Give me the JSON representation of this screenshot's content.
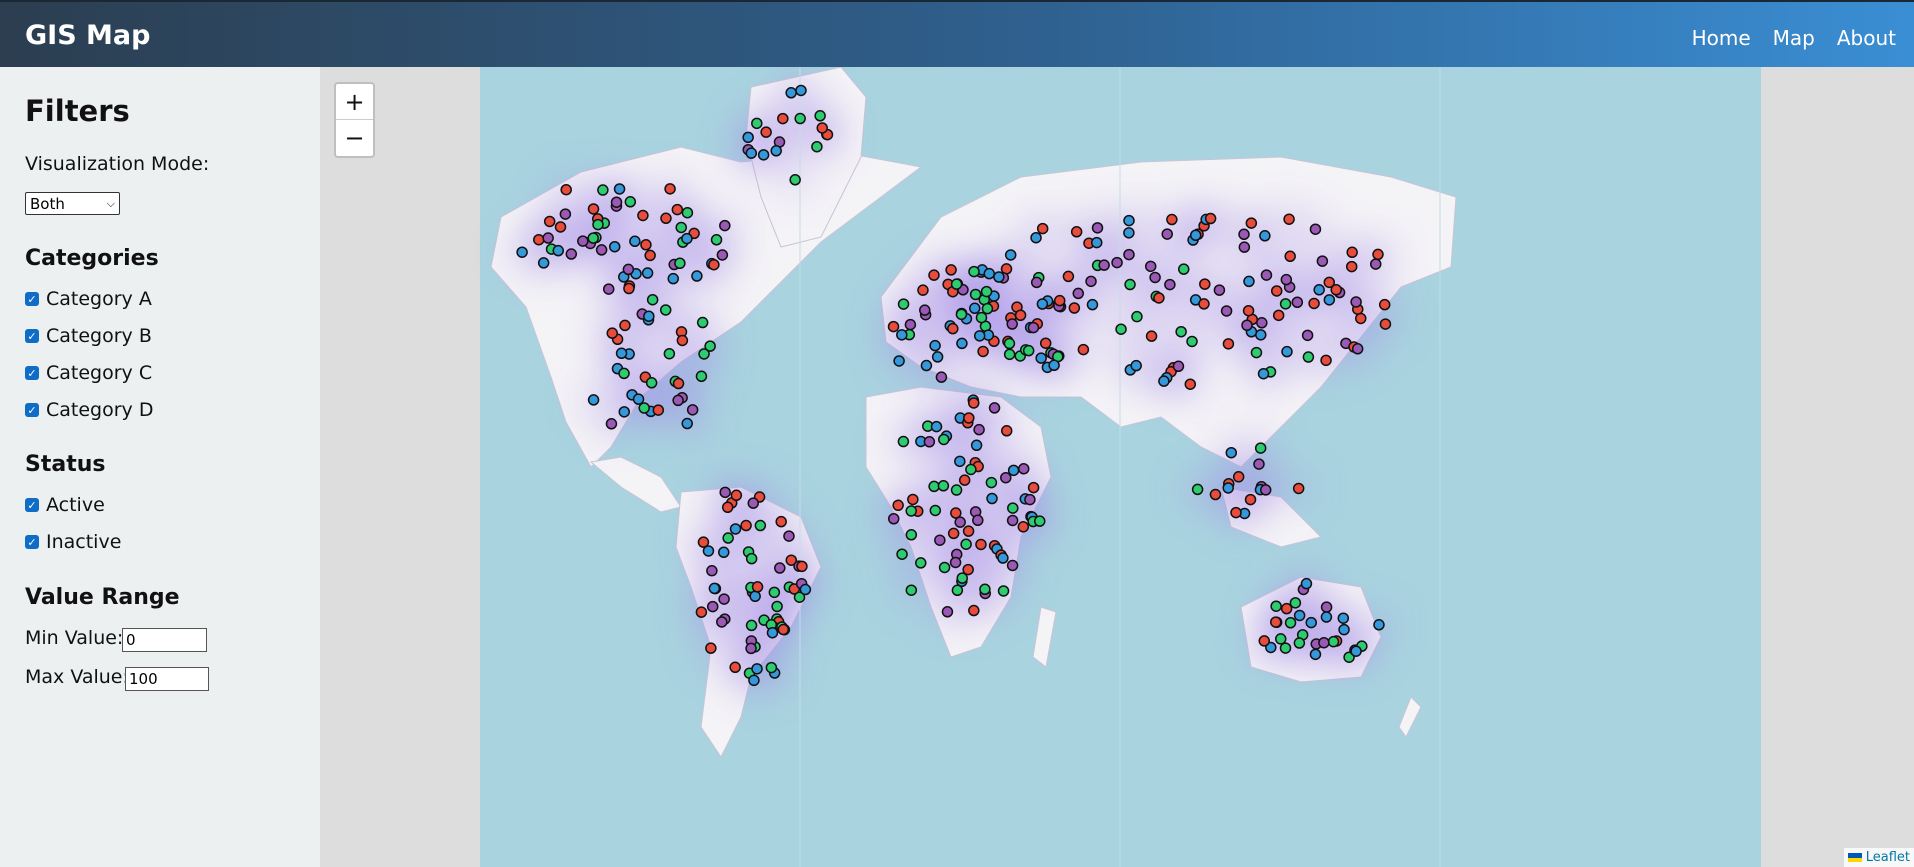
{
  "header": {
    "title": "GIS Map",
    "nav": [
      "Home",
      "Map",
      "About"
    ]
  },
  "sidebar": {
    "title": "Filters",
    "mode_label": "Visualization Mode:",
    "mode_value": "Both",
    "categories_title": "Categories",
    "categories": [
      "Category A",
      "Category B",
      "Category C",
      "Category D"
    ],
    "status_title": "Status",
    "statuses": [
      "Active",
      "Inactive"
    ],
    "range_title": "Value Range",
    "min_label": "Min Value:",
    "min_value": "0",
    "max_label": "Max Value:",
    "max_value": "100"
  },
  "map": {
    "zoom_in": "+",
    "zoom_out": "−",
    "attribution": "Leaflet",
    "marker_colors": [
      "#e74c3c",
      "#2ecc71",
      "#3498db",
      "#9b59b6"
    ],
    "ocean_color": "#a9d3df"
  }
}
